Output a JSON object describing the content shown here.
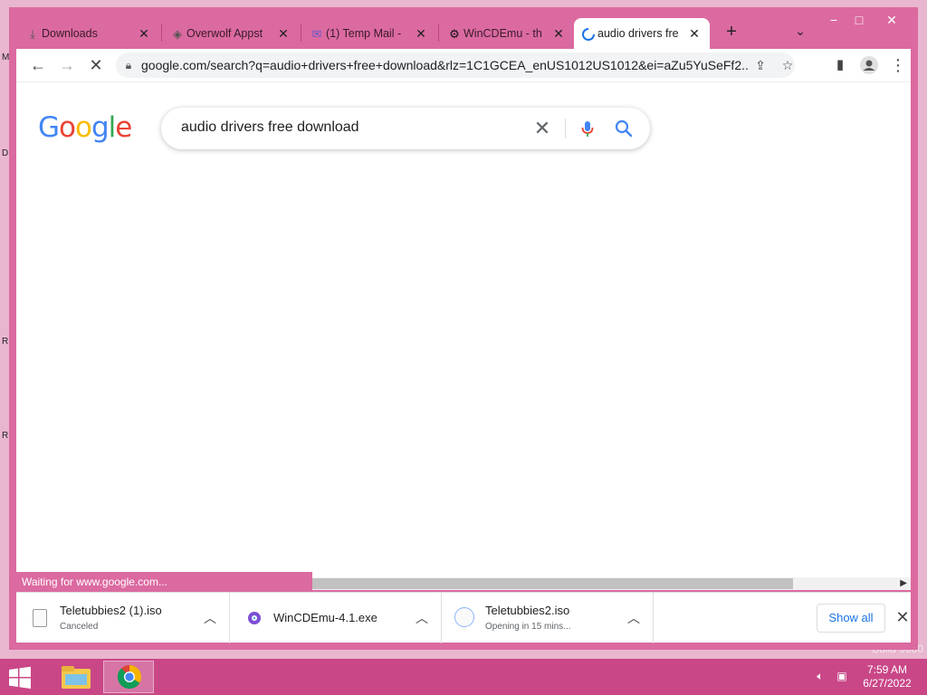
{
  "desktop": {
    "edge_letters": [
      "M",
      "D",
      "R",
      "R"
    ],
    "build_text": "Build 9600"
  },
  "window": {
    "title": "audio drivers free download",
    "controls": {
      "minimize": "−",
      "maximize": "□",
      "close": "✕"
    }
  },
  "tabs": [
    {
      "label": "Downloads",
      "icon": "download-icon",
      "active": false
    },
    {
      "label": "Overwolf Appst",
      "icon": "overwolf-icon",
      "active": false
    },
    {
      "label": "(1) Temp Mail -",
      "icon": "mail-icon",
      "active": false
    },
    {
      "label": "WinCDEmu - th",
      "icon": "gear-icon",
      "active": false
    },
    {
      "label": "audio drivers fre",
      "icon": "loading-spinner-icon",
      "active": true
    }
  ],
  "toolbar": {
    "url": "google.com/search?q=audio+drivers+free+download&rlz=1C1GCEA_enUS1012US1012&ei=aZu5YuSeFf2..."
  },
  "search": {
    "logo": "Google",
    "query": "audio drivers free download"
  },
  "status": {
    "text": "Waiting for www.google.com..."
  },
  "downloads": {
    "items": [
      {
        "name": "Teletubbies2 (1).iso",
        "status": "Canceled"
      },
      {
        "name": "WinCDEmu-4.1.exe",
        "status": ""
      },
      {
        "name": "Teletubbies2.iso",
        "status": "Opening in 15 mins..."
      }
    ],
    "show_all": "Show all"
  },
  "taskbar": {
    "time": "7:59 AM",
    "date": "6/27/2022"
  },
  "colors": {
    "window_frame": "#db6aa0",
    "taskbar": "#c94787",
    "desktop": "#e9b6cf",
    "link_blue": "#1a73e8"
  }
}
